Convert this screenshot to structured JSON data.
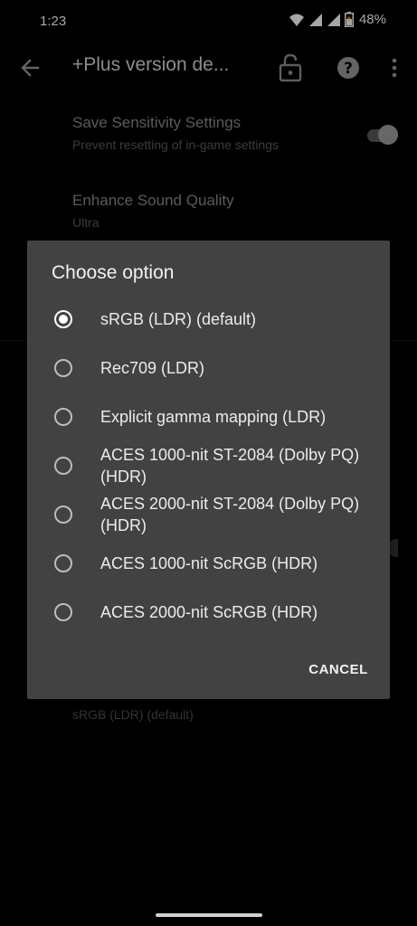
{
  "status_bar": {
    "time": "1:23",
    "battery_percent": "48%"
  },
  "app_bar": {
    "title": "+Plus version de..."
  },
  "settings": [
    {
      "title": "Save Sensitivity Settings",
      "subtitle": "Prevent resetting of in-game settings",
      "toggle": true
    },
    {
      "title": "Enhance Sound Quality",
      "subtitle": "Ultra"
    }
  ],
  "below_dialog_value": "sRGB (LDR) (default)",
  "dialog": {
    "title": "Choose option",
    "options": [
      {
        "label": "sRGB (LDR) (default)",
        "selected": true
      },
      {
        "label": "Rec709 (LDR)",
        "selected": false
      },
      {
        "label": "Explicit gamma mapping (LDR)",
        "selected": false
      },
      {
        "label": "ACES 1000-nit ST-2084 (Dolby PQ) (HDR)",
        "selected": false
      },
      {
        "label": "ACES 2000-nit ST-2084 (Dolby PQ) (HDR)",
        "selected": false
      },
      {
        "label": "ACES 1000-nit ScRGB (HDR)",
        "selected": false
      },
      {
        "label": "ACES 2000-nit ScRGB (HDR)",
        "selected": false
      }
    ],
    "cancel_label": "CANCEL"
  },
  "icons": {
    "back": "arrow-back-icon",
    "lock": "lock-icon",
    "help": "help-icon",
    "more": "more-vert-icon",
    "wifi": "wifi-icon",
    "signal": "signal-icon",
    "battery": "battery-icon"
  }
}
